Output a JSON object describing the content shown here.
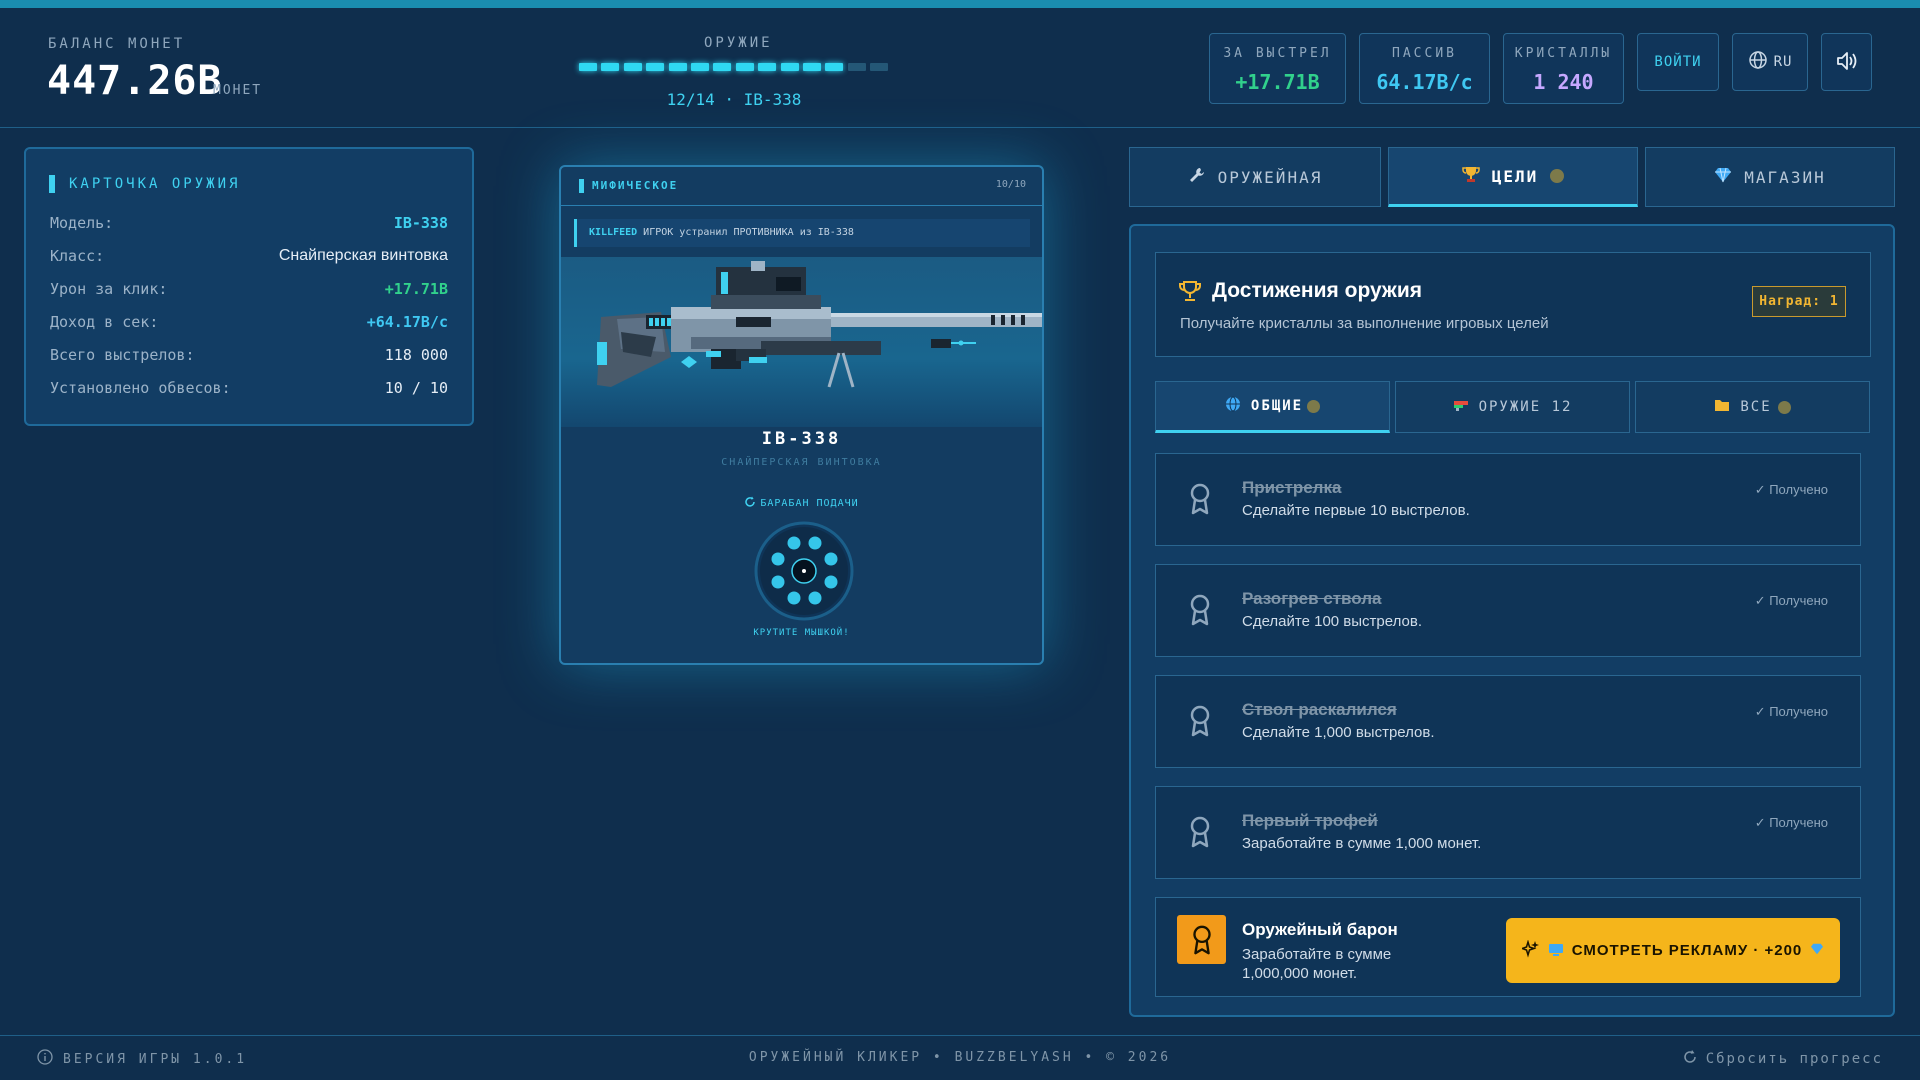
{
  "header": {
    "balance_label": "БАЛАНС МОНЕТ",
    "balance_value": "447.26B",
    "balance_unit": "МОНЕТ",
    "weapon_label": "ОРУЖИЕ",
    "weapon_progress": {
      "current": 12,
      "total": 14
    },
    "weapon_counter": "12/14 · IB-338",
    "stats": [
      {
        "label": "ЗА ВЫСТРЕЛ",
        "value": "+17.71B",
        "color": "#31d18c"
      },
      {
        "label": "ПАССИВ",
        "value": "64.17B/с",
        "color": "#3fc8f2"
      },
      {
        "label": "КРИСТАЛЛЫ",
        "value": "1 240",
        "color": "#c6a8ff"
      }
    ],
    "login_label": "ВОЙТИ",
    "lang_label": "RU",
    "lang_icon": "globe-icon",
    "sound_icon": "speaker-icon"
  },
  "card": {
    "title": "КАРТОЧКА ОРУЖИЯ",
    "rows": [
      {
        "key": "Модель:",
        "value": "IB-338",
        "color": "#3fd1f0"
      },
      {
        "key": "Класс:",
        "value": "Снайперская винтовка",
        "color": "#e6eef6"
      },
      {
        "key": "Урон за клик:",
        "value": "+17.71B",
        "color": "#31d18c"
      },
      {
        "key": "Доход в сек:",
        "value": "+64.17B/с",
        "color": "#3fc8f2"
      },
      {
        "key": "Всего выстрелов:",
        "value": "118 000",
        "color": "#e6eef6"
      },
      {
        "key": "Установлено обвесов:",
        "value": "10 / 10",
        "color": "#e6eef6"
      }
    ]
  },
  "weapon_panel": {
    "rarity": "МИФИЧЕСКОЕ",
    "level": "10/10",
    "killfeed_tag": "KILLFEED",
    "killfeed_text": "ИГРОК устранил ПРОТИВНИКА из IB-338",
    "name": "IB-338",
    "class": "СНАЙПЕРСКАЯ ВИНТОВКА",
    "drum_label": "БАРАБАН ПОДАЧИ",
    "drum_hint": "КРУТИТЕ МЫШКОЙ!"
  },
  "tabs": [
    {
      "label": "ОРУЖЕЙНАЯ",
      "icon": "wrench-icon",
      "active": false
    },
    {
      "label": "ЦЕЛИ",
      "icon": "trophy-icon",
      "active": true
    },
    {
      "label": "МАГАЗИН",
      "icon": "gem-icon",
      "active": false
    }
  ],
  "achievements": {
    "title": "Достижения оружия",
    "subtitle": "Получайте кристаллы за выполнение игровых целей",
    "reward_badge": "Наград: 1",
    "subtabs": [
      {
        "label": "ОБЩИЕ",
        "icon": "globe-icon",
        "active": true
      },
      {
        "label": "ОРУЖИЕ 12",
        "icon": "gun-icon",
        "active": false
      },
      {
        "label": "ВСЕ",
        "icon": "folder-icon",
        "active": false
      }
    ],
    "items": [
      {
        "title": "Пристрелка",
        "desc": "Сделайте первые 10 выстрелов.",
        "status": "Получено"
      },
      {
        "title": "Разогрев ствола",
        "desc": "Сделайте 100 выстрелов.",
        "status": "Получено"
      },
      {
        "title": "Ствол раскалился",
        "desc": "Сделайте 1,000 выстрелов.",
        "status": "Получено"
      },
      {
        "title": "Первый трофей",
        "desc": "Заработайте в сумме 1,000 монет.",
        "status": "Получено"
      }
    ],
    "locked": {
      "title": "Оружейный барон",
      "desc": "Заработайте в сумме 1,000,000 монет.",
      "ad_button": "СМОТРЕТЬ РЕКЛАМУ · +200"
    }
  },
  "footer": {
    "version": "ВЕРСИЯ ИГРЫ 1.0.1",
    "credits": "ОРУЖЕЙНЫЙ КЛИКЕР • BUZZBELYASH • © 2026",
    "reset": "Сбросить прогресс"
  }
}
